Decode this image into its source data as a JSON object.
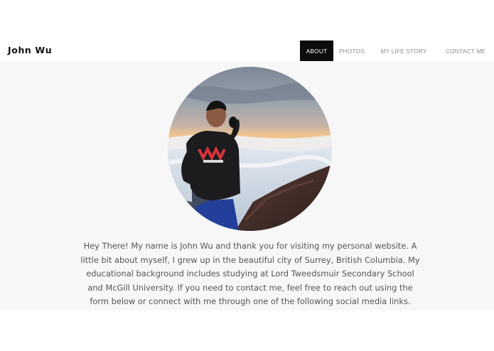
{
  "site": {
    "brand": "John Wu"
  },
  "nav": {
    "items": [
      {
        "label": "ABOUT",
        "active": true
      },
      {
        "label": "PHOTOS",
        "active": false
      },
      {
        "label": "MY LIFE STORY",
        "active": false
      },
      {
        "label": "CONTACT ME",
        "active": false
      }
    ]
  },
  "about": {
    "bio": "Hey There! My name is John Wu and thank you for visiting my personal website. A little bit about myself, I grew up in the beautiful city of Surrey, British Columbia. My educational background includes studying at Lord Tweedsmuir Secondary School and McGill University. If you need to contact me, feel free to reach out using the form below or connect with me through one of the following social media links.",
    "portrait": {
      "shirt_print": "ELITE SQUAD",
      "shirt_logo": "A A"
    }
  },
  "colors": {
    "active_nav_bg": "#0c0c0c",
    "nav_text": "#8d8d8d",
    "hero_bg": "#f7f7f7",
    "body_text": "#555555"
  }
}
